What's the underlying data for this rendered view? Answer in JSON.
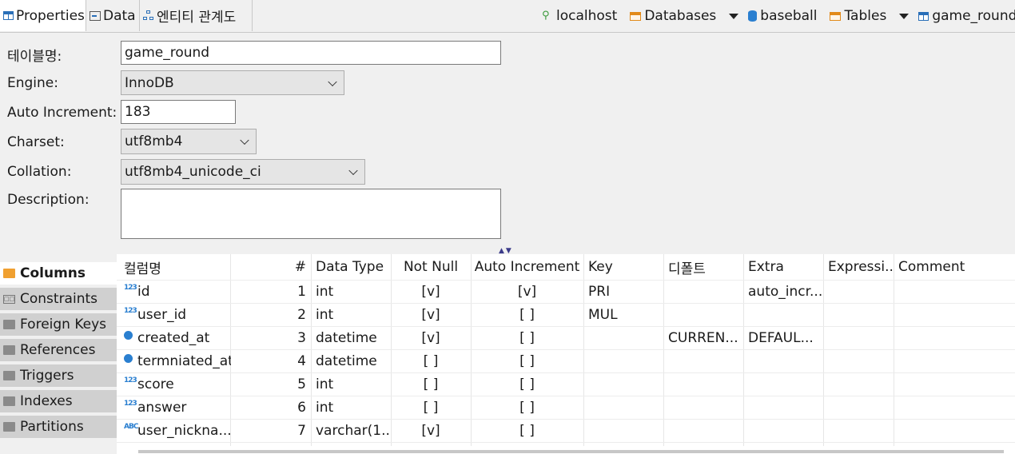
{
  "tabs": [
    {
      "label": "Properties",
      "icon": "table-icon",
      "active": true
    },
    {
      "label": "Data",
      "icon": "data-icon",
      "active": false
    },
    {
      "label": "엔티티 관계도",
      "icon": "er-diagram-icon",
      "active": false
    }
  ],
  "breadcrumb": {
    "host": "localhost",
    "databases": "Databases",
    "database": "baseball",
    "tables": "Tables",
    "table": "game_round"
  },
  "form": {
    "table_name_label": "테이블명:",
    "table_name_value": "game_round",
    "engine_label": "Engine:",
    "engine_value": "InnoDB",
    "auto_increment_label": "Auto Increment:",
    "auto_increment_value": "183",
    "charset_label": "Charset:",
    "charset_value": "utf8mb4",
    "collation_label": "Collation:",
    "collation_value": "utf8mb4_unicode_ci",
    "description_label": "Description:",
    "description_value": ""
  },
  "side_tabs": [
    {
      "label": "Columns",
      "active": true
    },
    {
      "label": "Constraints",
      "active": false
    },
    {
      "label": "Foreign Keys",
      "active": false
    },
    {
      "label": "References",
      "active": false
    },
    {
      "label": "Triggers",
      "active": false
    },
    {
      "label": "Indexes",
      "active": false
    },
    {
      "label": "Partitions",
      "active": false
    }
  ],
  "columns_table": {
    "headers": {
      "name": "컬럼명",
      "num": "#",
      "type": "Data Type",
      "not_null": "Not Null",
      "auto_inc": "Auto Increment",
      "key": "Key",
      "default": "디폴트",
      "extra": "Extra",
      "expr": "Expressi...",
      "comment": "Comment"
    },
    "rows": [
      {
        "icon": "numeric-icon",
        "name": "id",
        "num": "1",
        "type": "int",
        "not_null": "[v]",
        "auto_inc": "[v]",
        "key": "PRI",
        "default": "",
        "extra": "auto_incr...",
        "expr": "",
        "comment": ""
      },
      {
        "icon": "numeric-key-icon",
        "name": "user_id",
        "num": "2",
        "type": "int",
        "not_null": "[v]",
        "auto_inc": "[ ]",
        "key": "MUL",
        "default": "",
        "extra": "",
        "expr": "",
        "comment": ""
      },
      {
        "icon": "clock-icon",
        "name": "created_at",
        "num": "3",
        "type": "datetime",
        "not_null": "[v]",
        "auto_inc": "[ ]",
        "key": "",
        "default": "CURREN...",
        "extra": "DEFAUL...",
        "expr": "",
        "comment": ""
      },
      {
        "icon": "clock-icon",
        "name": "termniated_at",
        "num": "4",
        "type": "datetime",
        "not_null": "[ ]",
        "auto_inc": "[ ]",
        "key": "",
        "default": "",
        "extra": "",
        "expr": "",
        "comment": ""
      },
      {
        "icon": "numeric-icon",
        "name": "score",
        "num": "5",
        "type": "int",
        "not_null": "[ ]",
        "auto_inc": "[ ]",
        "key": "",
        "default": "",
        "extra": "",
        "expr": "",
        "comment": ""
      },
      {
        "icon": "numeric-icon",
        "name": "answer",
        "num": "6",
        "type": "int",
        "not_null": "[ ]",
        "auto_inc": "[ ]",
        "key": "",
        "default": "",
        "extra": "",
        "expr": "",
        "comment": ""
      },
      {
        "icon": "text-icon",
        "name": "user_nickna...",
        "num": "7",
        "type": "varchar(1...",
        "not_null": "[v]",
        "auto_inc": "[ ]",
        "key": "",
        "default": "",
        "extra": "",
        "expr": "",
        "comment": ""
      }
    ]
  }
}
